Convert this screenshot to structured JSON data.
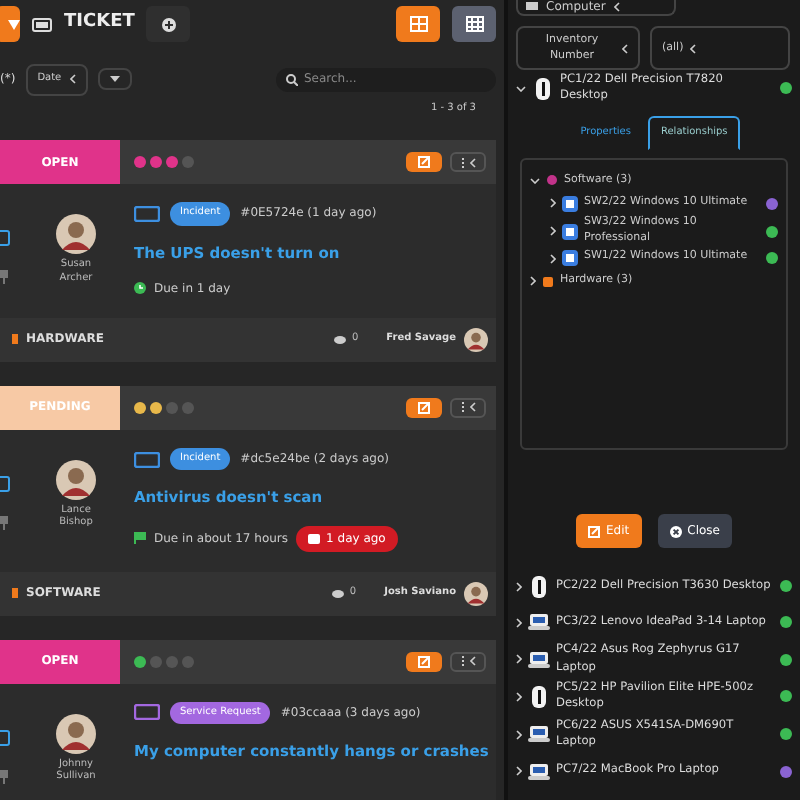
{
  "header": {
    "title": "TICKET"
  },
  "view_buttons": [
    {
      "kind": "grid",
      "selected": true
    },
    {
      "kind": "table",
      "selected": false
    }
  ],
  "filters": {
    "partial_label": "(*)",
    "sort": "Date",
    "search_placeholder": "Search..."
  },
  "pagination": "1 - 3 of 3",
  "tickets": [
    {
      "status": "OPEN",
      "color": "#e0338a",
      "dots": [
        {
          "color": "#e0338a"
        },
        {
          "color": "#e0338a"
        },
        {
          "color": "#e0338a"
        },
        {
          "color": "#555555"
        }
      ],
      "type": {
        "label": "Incident",
        "color": "#3d8fe0"
      },
      "ref": "#0E5724e (1 day ago)",
      "requester": "Susan Archer",
      "title": "The UPS doesn't turn on",
      "due": {
        "text": "Due in 1 day",
        "kind": "clock"
      },
      "category": "HARDWARE",
      "count": "0",
      "assignee": "Fred Savage"
    },
    {
      "status": "PENDING",
      "color": "#f7c9a5",
      "dots": [
        {
          "color": "#e8b84a"
        },
        {
          "color": "#e8b84a"
        },
        {
          "color": "#555555"
        },
        {
          "color": "#555555"
        }
      ],
      "type": {
        "label": "Incident",
        "color": "#3d8fe0"
      },
      "ref": "#dc5e24be (2 days ago)",
      "requester": "Lance Bishop",
      "title": "Antivirus doesn't scan",
      "due": {
        "text": "Due in about 17 hours",
        "kind": "flag"
      },
      "overdue": "1 day ago",
      "category": "SOFTWARE",
      "count": "0",
      "assignee": "Josh Saviano"
    },
    {
      "status": "OPEN",
      "color": "#e0338a",
      "dots": [
        {
          "color": "#3cba54"
        },
        {
          "color": "#555555"
        },
        {
          "color": "#555555"
        },
        {
          "color": "#555555"
        }
      ],
      "type": {
        "label": "Service Request",
        "color": "#a368e0"
      },
      "ref": "#03ccaaa (3 days ago)",
      "requester": "Johnny Sullivan",
      "title": "My computer constantly hangs or crashes"
    }
  ],
  "side": {
    "type_filter": "Computer",
    "filters": [
      "Inventory Number",
      "(all)"
    ],
    "items": [
      {
        "name": "PC1/22 Dell Precision T7820 Desktop",
        "kind": "desktop",
        "color": "#3cba54",
        "expanded": true,
        "detail": {
          "tabs": [
            {
              "label": "Properties",
              "selected": false
            },
            {
              "label": "Relationships",
              "selected": true
            }
          ],
          "groups": [
            {
              "label": "Software (3)",
              "kind": "software",
              "expanded": true,
              "children": [
                {
                  "label": "SW2/22 Windows 10 Ultimate",
                  "color": "#8a63d2"
                },
                {
                  "label": "SW3/22 Windows 10 Professional",
                  "color": "#3cba54"
                },
                {
                  "label": "SW1/22 Windows 10 Ultimate",
                  "color": "#3cba54"
                }
              ]
            },
            {
              "label": "Hardware (3)",
              "kind": "hardware",
              "expanded": false
            }
          ],
          "buttons": [
            {
              "label": "Edit",
              "kind": "primary"
            },
            {
              "label": "Close",
              "kind": "secondary"
            }
          ]
        }
      },
      {
        "name": "PC2/22 Dell Precision T3630 Desktop",
        "kind": "desktop",
        "color": "#3cba54",
        "expanded": false
      },
      {
        "name": "PC3/22 Lenovo IdeaPad 3-14 Laptop",
        "kind": "laptop",
        "color": "#3cba54",
        "expanded": false
      },
      {
        "name": "PC4/22 Asus Rog Zephyrus G17 Laptop",
        "kind": "laptop",
        "color": "#3cba54",
        "expanded": false
      },
      {
        "name": "PC5/22 HP Pavilion Elite HPE-500z Desktop",
        "kind": "desktop",
        "color": "#3cba54",
        "expanded": false
      },
      {
        "name": "PC6/22 ASUS X541SA-DM690T Laptop",
        "kind": "laptop",
        "color": "#3cba54",
        "expanded": false
      },
      {
        "name": "PC7/22 MacBook Pro Laptop",
        "kind": "laptop",
        "color": "#8a63d2",
        "expanded": false
      }
    ]
  }
}
